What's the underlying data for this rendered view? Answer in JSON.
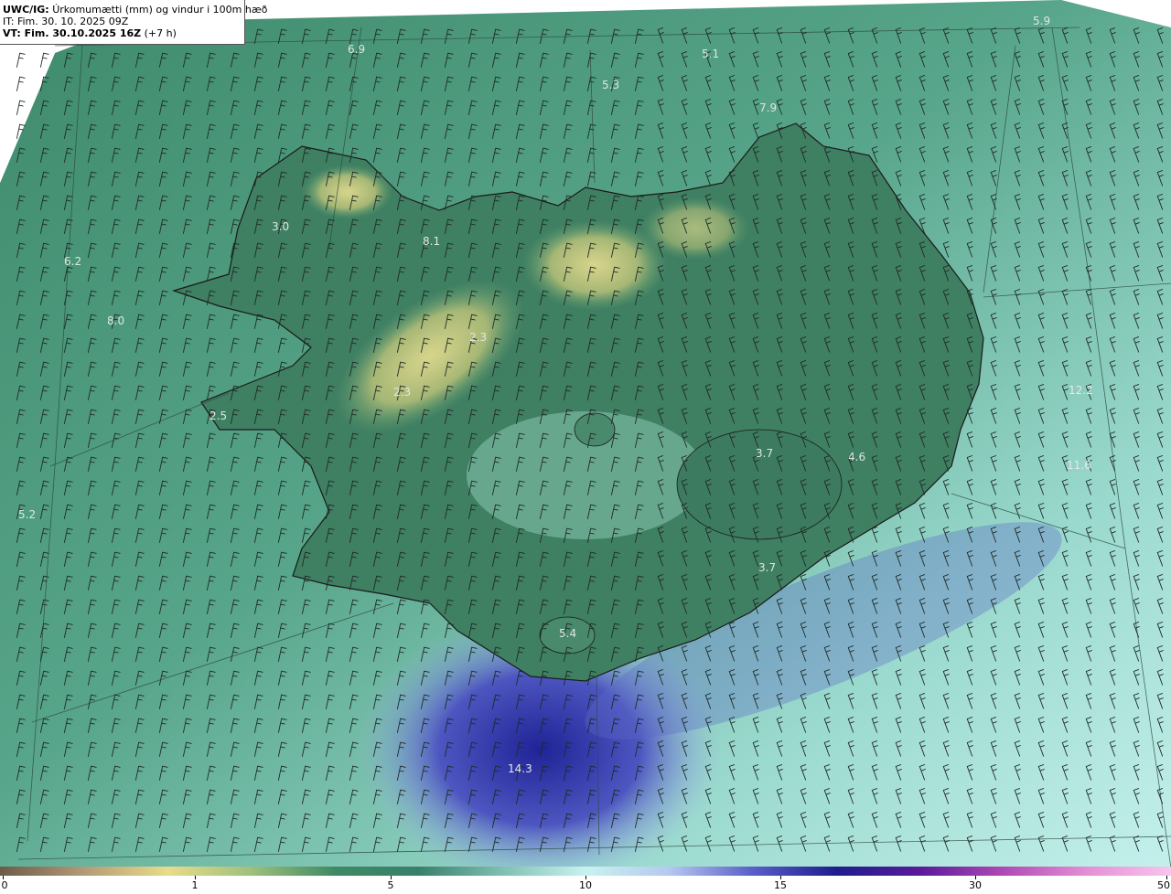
{
  "header": {
    "title_prefix": "UWC/IG:",
    "title_text": "Úrkomumætti (mm) og vindur i 100m hæð",
    "issue_time": "IT: Fim. 30. 10. 2025 09Z",
    "valid_prefix": "VT: Fim. 30.10.2025 16Z",
    "valid_suffix": "(+7 h)"
  },
  "map_labels": [
    {
      "text": "6.9"
    },
    {
      "text": "5.1"
    },
    {
      "text": "5.3"
    },
    {
      "text": "5.9"
    },
    {
      "text": "7.9"
    },
    {
      "text": "3.0"
    },
    {
      "text": "8.1"
    },
    {
      "text": "6.2"
    },
    {
      "text": "8.0"
    },
    {
      "text": "2.3"
    },
    {
      "text": "2.3"
    },
    {
      "text": "2.5"
    },
    {
      "text": "3.7"
    },
    {
      "text": "4.6"
    },
    {
      "text": "12.2"
    },
    {
      "text": "11.6"
    },
    {
      "text": "5.2"
    },
    {
      "text": "3.7"
    },
    {
      "text": "5.4"
    },
    {
      "text": "14.3"
    }
  ],
  "colorbar": {
    "ticks": [
      "0",
      "1",
      "5",
      "10",
      "15",
      "30",
      "50"
    ],
    "colors": [
      "#6e5a4a",
      "#b39a77",
      "#e8dc8a",
      "#9fc07c",
      "#3f8a64",
      "#3a7f6a",
      "#7fbfb2",
      "#c9f2ef",
      "#b6c8ef",
      "#5a5ec8",
      "#1e1d8c",
      "#5a1a9a",
      "#b04ab4",
      "#e58fd5",
      "#f6c6ee"
    ]
  },
  "colors": {
    "sea": "#4e9a82",
    "land_low": "#3b7f62",
    "land_high": "#c8c980",
    "heavy_precip": "#2c2fa0",
    "coast": "#1a1a1a"
  }
}
